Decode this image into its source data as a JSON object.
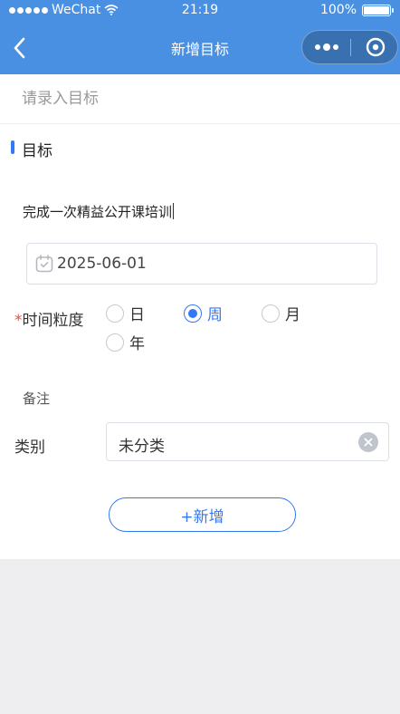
{
  "status_bar": {
    "carrier": "WeChat",
    "time": "21:19",
    "battery": "100%"
  },
  "nav": {
    "title": "新增目标"
  },
  "form": {
    "target_placeholder": "请录入目标",
    "section_title": "目标",
    "goal_text": "完成一次精益公开课培训",
    "date": "2025-06-01",
    "granularity": {
      "required_mark": "*",
      "label": "时间粒度",
      "options": [
        "日",
        "周",
        "月",
        "年"
      ],
      "selected": "周"
    },
    "remark_label": "备注",
    "category": {
      "label": "类别",
      "value": "未分类"
    },
    "add_button": "+新增"
  },
  "colors": {
    "header": "#4a90e2",
    "accent": "#3478f6",
    "required": "#e54d42",
    "background": "#eeedf0"
  }
}
